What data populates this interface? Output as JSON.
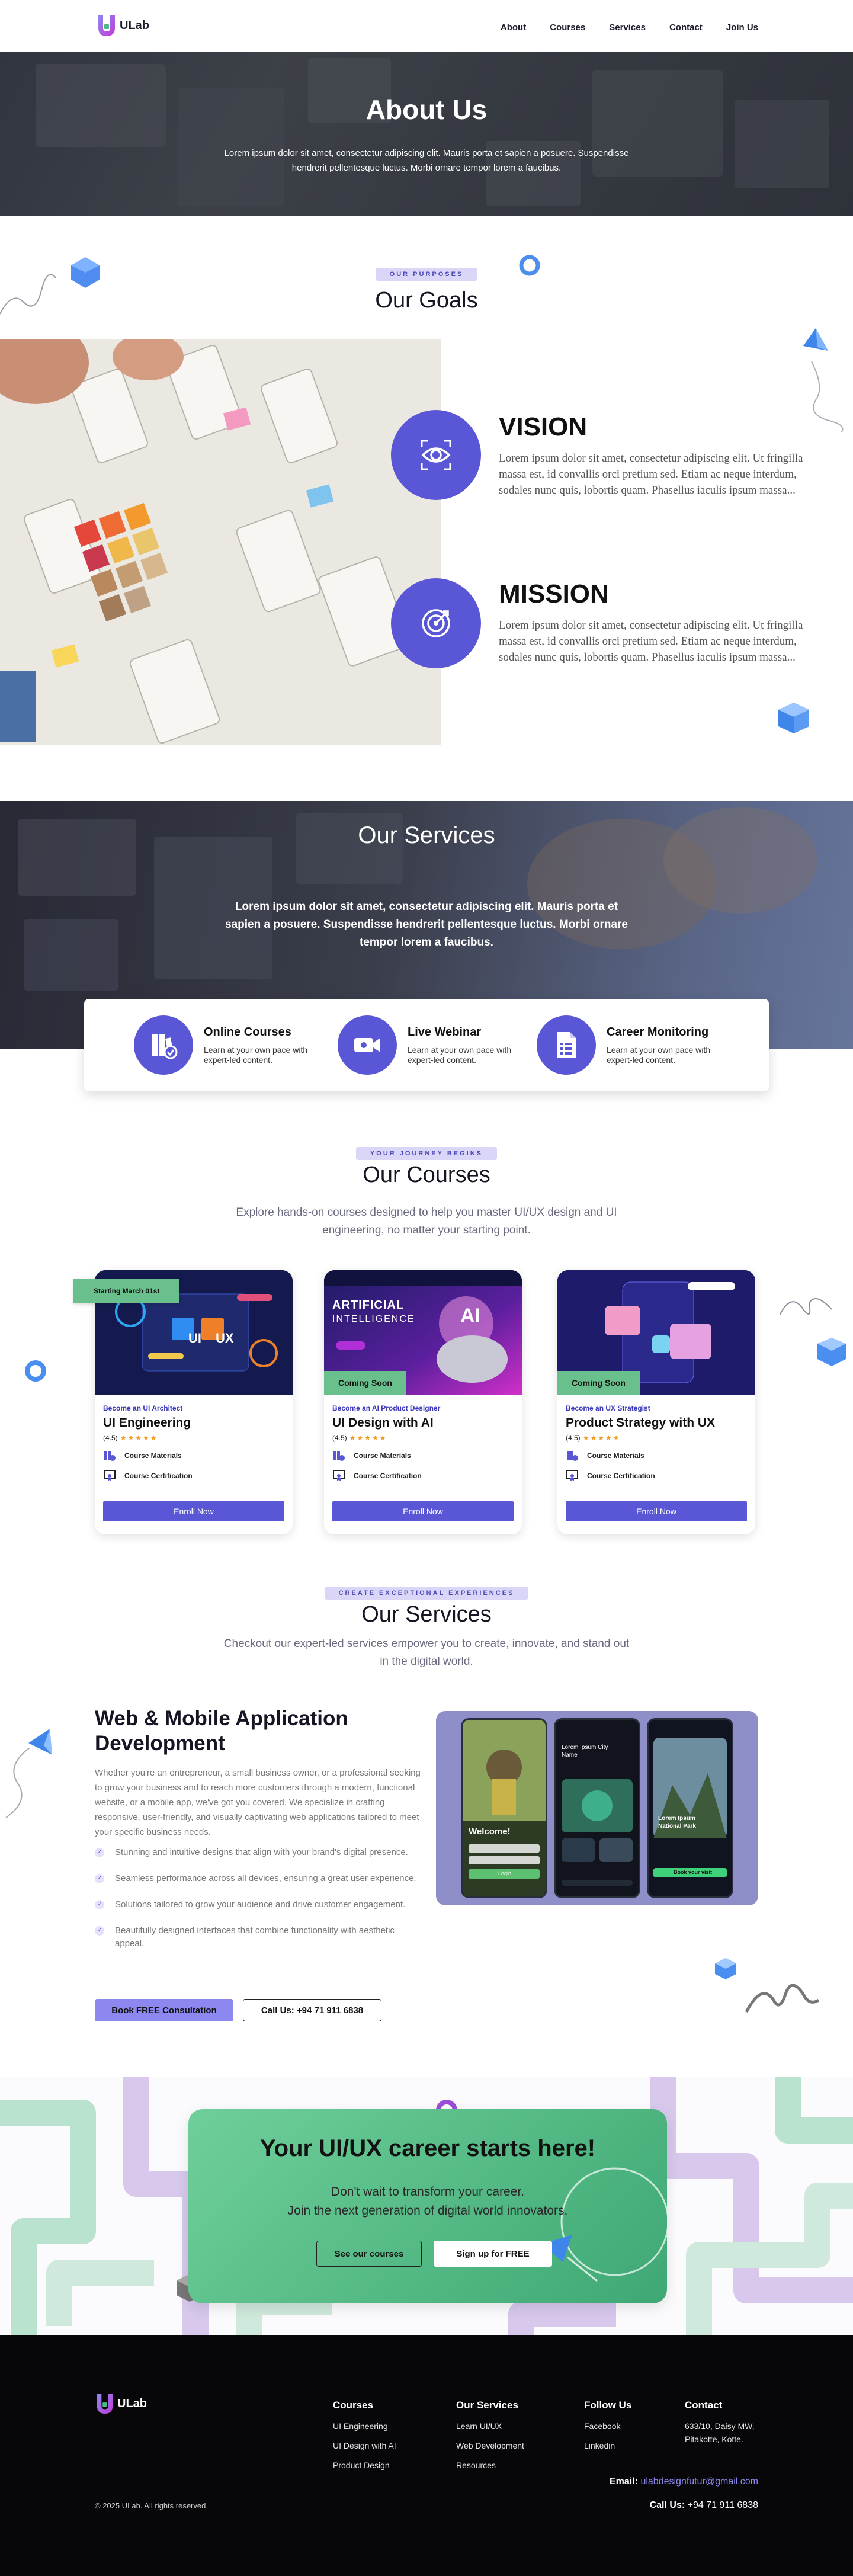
{
  "brand": {
    "name": "ULab",
    "accent": "#5a57d6",
    "accent_light": "#8c88f0",
    "green": "#4cb882"
  },
  "nav": [
    "About",
    "Courses",
    "Services",
    "Contact",
    "Join Us"
  ],
  "hero": {
    "title": "About Us",
    "subtitle": "Lorem ipsum dolor sit amet, consectetur adipiscing elit. Mauris porta et sapien a posuere. Suspendisse hendrerit pellentesque luctus. Morbi ornare tempor lorem a faucibus."
  },
  "goals": {
    "badge": "OUR PURPOSES",
    "title": "Our Goals",
    "vision": {
      "title": "VISION",
      "icon": "eye-icon",
      "text": "Lorem ipsum dolor sit amet, consectetur adipiscing elit. Ut fringilla massa est, id convallis orci pretium sed. Etiam ac neque interdum, sodales nunc quis, lobortis quam. Phasellus iaculis ipsum massa..."
    },
    "mission": {
      "title": "MISSION",
      "icon": "target-icon",
      "text": "Lorem ipsum dolor sit amet, consectetur adipiscing elit. Ut fringilla massa est, id convallis orci pretium sed. Etiam ac neque interdum, sodales nunc quis, lobortis quam. Phasellus iaculis ipsum massa..."
    }
  },
  "services_banner": {
    "title": "Our Services",
    "text": "Lorem ipsum dolor sit amet, consectetur adipiscing elit. Mauris porta et sapien a posuere. Suspendisse hendrerit pellentesque luctus. Morbi ornare tempor lorem a faucibus.",
    "items": [
      {
        "title": "Online Courses",
        "text": "Learn at your own pace with expert-led content.",
        "icon": "books-icon"
      },
      {
        "title": "Live Webinar",
        "text": "Learn at your own pace with expert-led content.",
        "icon": "video-camera-icon"
      },
      {
        "title": "Career Monitoring",
        "text": "Learn at your own pace with expert-led content.",
        "icon": "document-icon"
      }
    ]
  },
  "courses": {
    "badge": "YOUR JOURNEY BEGINS",
    "title": "Our Courses",
    "subtitle": "Explore hands-on courses designed to help you master UI/UX design and UI engineering, no matter your starting point.",
    "items": [
      {
        "tag": "Starting March 01st",
        "role": "Become an UI Architect",
        "title": "UI Engineering",
        "rating": "(4.5)",
        "stars": "★★★★★",
        "materials": "Course Materials",
        "certification": "Course Certification",
        "button": "Enroll Now"
      },
      {
        "tag": "Coming Soon",
        "role": "Become an AI Product Designer",
        "title": "UI Design with AI",
        "rating": "(4.5)",
        "stars": "★★★★★",
        "materials": "Course Materials",
        "certification": "Course Certification",
        "button": "Enroll Now",
        "art_title": "ARTIFICIAL",
        "art_sub": "INTELLIGENCE"
      },
      {
        "tag": "Coming Soon",
        "role": "Become an UX Strategist",
        "title": "Product Strategy with UX",
        "rating": "(4.5)",
        "stars": "★★★★★",
        "materials": "Course Materials",
        "certification": "Course Certification",
        "button": "Enroll Now"
      }
    ]
  },
  "services": {
    "badge": "CREATE EXCEPTIONAL EXPERIENCES",
    "title": "Our Services",
    "subtitle": "Checkout our expert-led services empower you to create, innovate, and stand out in the digital world.",
    "feature_title": "Web & Mobile Application Development",
    "feature_text": "Whether you're an entrepreneur, a small business owner, or a professional seeking to grow your business and to reach more customers through a modern, functional website, or a mobile app, we've got you covered. We specialize in crafting responsive, user-friendly, and visually captivating web applications tailored to meet your specific business needs.",
    "bullets": [
      "Stunning and intuitive designs that align with your brand's digital presence.",
      "Seamless performance across all devices, ensuring a great user experience.",
      "Solutions tailored to grow your audience and drive customer engagement.",
      "Beautifully designed interfaces that combine functionality with aesthetic appeal."
    ],
    "btn_consult": "Book FREE Consultation",
    "btn_call": "Call Us: +94 71 911 6838",
    "phone1": {
      "welcome": "Welcome!",
      "btn": "Login"
    },
    "phone2": {
      "title": "Lorem Ipsum City Name"
    },
    "phone3": {
      "title": "Lorem Ipsum National Park",
      "btn": "Book your visit"
    }
  },
  "cta": {
    "title": "Your UI/UX career starts here!",
    "subtitle1": "Don't wait to transform your career.",
    "subtitle2": "Join the next generation of digital world innovators.",
    "btn_courses": "See our courses",
    "btn_signup": "Sign up for FREE"
  },
  "footer": {
    "brand": "ULab",
    "columns": [
      {
        "title": "Courses",
        "items": [
          "UI Engineering",
          "UI Design with AI",
          "Product Design"
        ]
      },
      {
        "title": "Our Services",
        "items": [
          "Learn UI/UX",
          "Web Development",
          "Resources"
        ]
      },
      {
        "title": "Follow Us",
        "items": [
          "Facebook",
          "Linkedin"
        ]
      },
      {
        "title": "Contact",
        "items": [
          "633/10, Daisy MW,",
          "Pitakotte, Kotte."
        ]
      }
    ],
    "email_label": "Email:",
    "email": "ulabdesignfutur@gmail.com",
    "call_label": "Call Us:",
    "phone": "+94 71 911 6838",
    "copyright": "© 2025 ULab. All rights reserved."
  }
}
